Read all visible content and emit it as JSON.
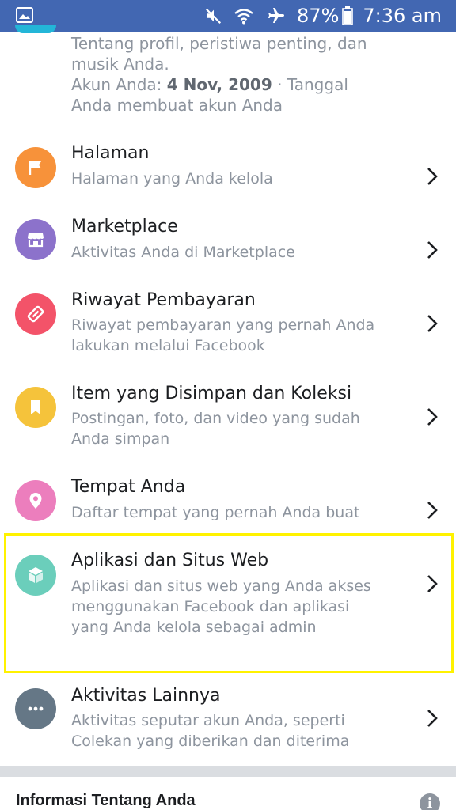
{
  "status_bar": {
    "battery_percent": "87%",
    "time": "7:36 am",
    "icons": [
      "gallery-icon",
      "mute-icon",
      "wifi-icon",
      "airplane-mode-icon",
      "battery-icon"
    ]
  },
  "profile_fragment": {
    "line1": "Tentang profil, peristiwa penting, dan",
    "line2": "musik Anda.",
    "account_prefix": "Akun Anda: ",
    "account_date": "4 Nov, 2009",
    "account_suffix": " · Tanggal",
    "line4": "Anda membuat akun Anda"
  },
  "items": [
    {
      "title": "Halaman",
      "subtitle": "Halaman yang Anda kelola",
      "color": "#f7923a",
      "icon": "flag-icon"
    },
    {
      "title": "Marketplace",
      "subtitle": "Aktivitas Anda di Marketplace",
      "color": "#8c72cb",
      "icon": "shop-icon"
    },
    {
      "title": "Riwayat Pembayaran",
      "subtitle": "Riwayat pembayaran yang pernah Anda lakukan melalui Facebook",
      "color": "#f35369",
      "icon": "tag-icon"
    },
    {
      "title": "Item yang Disimpan dan Koleksi",
      "subtitle": "Postingan, foto, dan video yang sudah Anda simpan",
      "color": "#f5c33b",
      "icon": "bookmark-icon"
    },
    {
      "title": "Tempat Anda",
      "subtitle": "Daftar tempat yang pernah Anda buat",
      "color": "#ec7ebd",
      "icon": "location-pin-icon"
    },
    {
      "title": "Aplikasi dan Situs Web",
      "subtitle": "Aplikasi dan situs web yang Anda akses menggunakan Facebook dan aplikasi yang Anda kelola sebagai admin",
      "color": "#6bcebb",
      "icon": "cube-icon"
    },
    {
      "title": "Aktivitas Lainnya",
      "subtitle": "Aktivitas seputar akun Anda, seperti Colekan yang diberikan dan diterima",
      "color": "#657786",
      "icon": "more-dots-icon"
    }
  ],
  "section": {
    "header": "Informasi Tentang Anda",
    "info_icon_glyph": "i"
  },
  "colors": {
    "status_bar": "#4267b2",
    "highlight": "#fff200",
    "title_text": "#1c1e21",
    "subtitle_text": "#8d949e"
  }
}
